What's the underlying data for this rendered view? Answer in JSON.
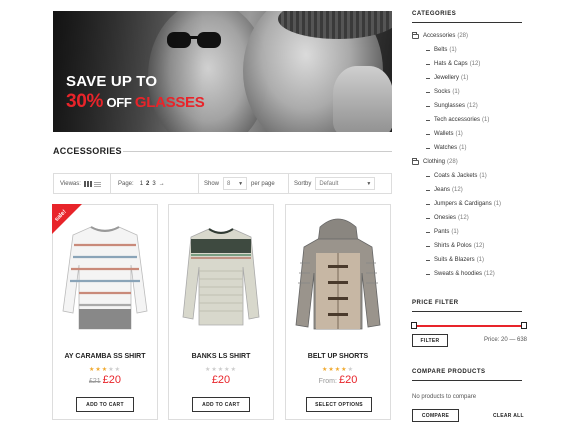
{
  "banner": {
    "line1": "SAVE UP TO",
    "line2_pct": "30%",
    "line2_off": " OFF ",
    "line2_item": "GLASSES"
  },
  "section": {
    "title": "ACCESSORIES"
  },
  "toolbar": {
    "view_label": "Viewas:",
    "page_label": "Page:",
    "pages": [
      "1",
      "2",
      "3"
    ],
    "next": "→",
    "show_label": "Show",
    "show_value": "8",
    "per_page": "per page",
    "sort_label": "Sortby",
    "sort_value": "Default"
  },
  "products": [
    {
      "name": "AY CARAMBA SS SHIRT",
      "rating": 3,
      "old_price": "£21",
      "price": "£20",
      "button": "ADD TO CART",
      "sale": "sale!"
    },
    {
      "name": "BANKS LS SHIRT",
      "rating": 0,
      "price": "£20",
      "button": "ADD TO CART"
    },
    {
      "name": "BELT UP SHORTS",
      "rating": 4,
      "from": "From:",
      "price": "£20",
      "button": "SELECT OPTIONS"
    }
  ],
  "sidebar": {
    "categories_title": "CATEGORIES",
    "categories": [
      {
        "label": "Accessories",
        "count": "(28)",
        "level": 0
      },
      {
        "label": "Belts",
        "count": "(1)",
        "level": 1
      },
      {
        "label": "Hats & Caps",
        "count": "(12)",
        "level": 1
      },
      {
        "label": "Jewellery",
        "count": "(1)",
        "level": 1
      },
      {
        "label": "Socks",
        "count": "(1)",
        "level": 1
      },
      {
        "label": "Sunglasses",
        "count": "(12)",
        "level": 1
      },
      {
        "label": "Tech accessories",
        "count": "(1)",
        "level": 1
      },
      {
        "label": "Wallets",
        "count": "(1)",
        "level": 1
      },
      {
        "label": "Watches",
        "count": "(1)",
        "level": 1
      },
      {
        "label": "Clothing",
        "count": "(28)",
        "level": 0
      },
      {
        "label": "Coats & Jackets",
        "count": "(1)",
        "level": 1
      },
      {
        "label": "Jeans",
        "count": "(12)",
        "level": 1
      },
      {
        "label": "Jumpers & Cardigans",
        "count": "(1)",
        "level": 1
      },
      {
        "label": "Onesies",
        "count": "(12)",
        "level": 1
      },
      {
        "label": "Pants",
        "count": "(1)",
        "level": 1
      },
      {
        "label": "Shirts & Polos",
        "count": "(12)",
        "level": 1
      },
      {
        "label": "Suits & Blazers",
        "count": "(1)",
        "level": 1
      },
      {
        "label": "Sweats & hoodies",
        "count": "(12)",
        "level": 1
      }
    ],
    "price_title": "PRICE FILTER",
    "filter_button": "FILTER",
    "price_range": "Price: 20 — 638",
    "compare_title": "COMPARE PRODUCTS",
    "compare_empty": "No products to compare",
    "compare_button": "COMPARE",
    "clear_all": "CLEAR ALL"
  },
  "colors": {
    "accent": "#e8242a",
    "star": "#f0a92e"
  }
}
